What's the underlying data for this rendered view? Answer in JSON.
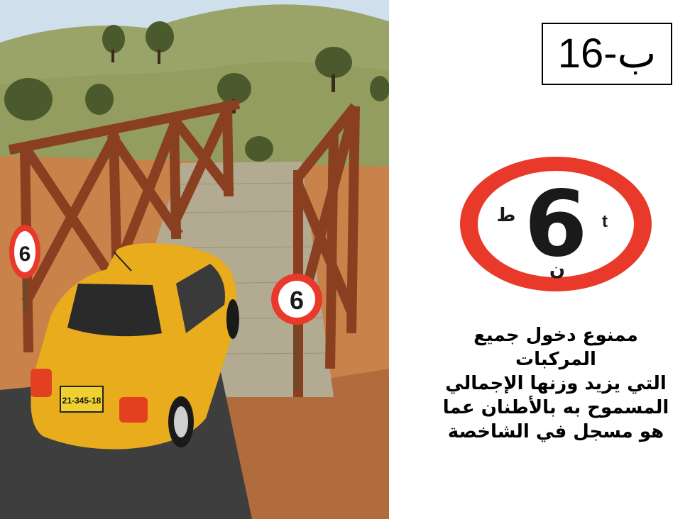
{
  "sign_code": "ب-16",
  "sign": {
    "weight_value": "6",
    "latin_unit": "t",
    "arabic_unit_left": "ط",
    "arabic_unit_below": "ن",
    "ring_color": "#e8392b",
    "face_color": "#ffffff",
    "symbol_color": "#1a1a1a"
  },
  "scene": {
    "plate_number": "21-345-18",
    "car_color": "#e8ac1d",
    "bridge_color": "#8a4020",
    "sky_color": "#cfe0ec",
    "hill_color": "#9aa468",
    "ground_color": "#c8824a"
  },
  "description_lines": [
    "ممنوع دخول جميع",
    "المركبات",
    "التي يزيد وزنها الإجمالي",
    "المسموح به بالأطنان عما",
    "هو مسجل في الشاخصة"
  ]
}
